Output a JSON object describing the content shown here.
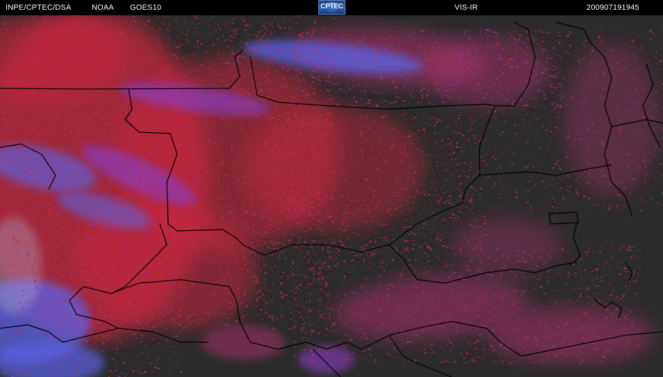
{
  "header": {
    "source": "INPE/CPTEC/DSA",
    "agency": "NOAA",
    "satellite": "GOES10",
    "channel": "VIS-IR",
    "timestamp": "200907191945"
  },
  "logo": {
    "text": "CPTEC"
  },
  "palette": {
    "background": "#2b2b2b",
    "cloud_red": "#c8283c",
    "cloud_magenta": "#b0306e",
    "cloud_violet": "#8a3cc0",
    "cloud_blue": "#5a62e6",
    "cloud_white": "#b4b4dc",
    "border_line": "#000000"
  }
}
